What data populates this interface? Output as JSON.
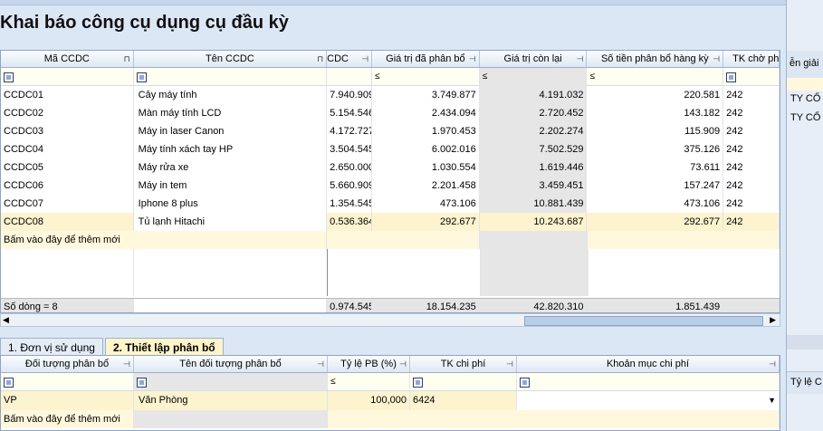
{
  "page_title": "Khai báo công cụ dụng cụ đầu kỳ",
  "main_grid": {
    "columns": [
      "Mã CCDC",
      "Tên CCDC",
      "CDC",
      "Giá trị đã phân bổ",
      "Giá trị còn lại",
      "Số tiền phân bổ hàng kỳ",
      "TK chờ ph"
    ],
    "filter_ops": [
      "≤",
      "≤",
      "≤"
    ],
    "rows": [
      {
        "code": "CCDC01",
        "name": "Cây máy tính",
        "cost": "7.940.909",
        "allocated": "3.749.877",
        "remaining": "4.191.032",
        "per_period": "220.581",
        "account": "242"
      },
      {
        "code": "CCDC02",
        "name": "Màn máy tính LCD",
        "cost": "5.154.546",
        "allocated": "2.434.094",
        "remaining": "2.720.452",
        "per_period": "143.182",
        "account": "242"
      },
      {
        "code": "CCDC03",
        "name": "Máy in laser Canon",
        "cost": "4.172.727",
        "allocated": "1.970.453",
        "remaining": "2.202.274",
        "per_period": "115.909",
        "account": "242"
      },
      {
        "code": "CCDC04",
        "name": "Máy tính xách tay HP",
        "cost": "3.504.545",
        "allocated": "6.002.016",
        "remaining": "7.502.529",
        "per_period": "375.126",
        "account": "242"
      },
      {
        "code": "CCDC05",
        "name": "Máy rửa xe",
        "cost": "2.650.000",
        "allocated": "1.030.554",
        "remaining": "1.619.446",
        "per_period": "73.611",
        "account": "242"
      },
      {
        "code": "CCDC06",
        "name": "Máy in tem",
        "cost": "5.660.909",
        "allocated": "2.201.458",
        "remaining": "3.459.451",
        "per_period": "157.247",
        "account": "242"
      },
      {
        "code": "CCDC07",
        "name": "Iphone 8 plus",
        "cost": "1.354.545",
        "allocated": "473.106",
        "remaining": "10.881.439",
        "per_period": "473.106",
        "account": "242"
      },
      {
        "code": "CCDC08",
        "name": "Tủ lạnh Hitachi",
        "cost": "0.536.364",
        "allocated": "292.677",
        "remaining": "10.243.687",
        "per_period": "292.677",
        "account": "242"
      }
    ],
    "add_row_text": "Bấm vào đây để thêm mới",
    "summary": {
      "count": "Số dòng = 8",
      "cost": "0.974.545",
      "allocated": "18.154.235",
      "remaining": "42.820.310",
      "per_period": "1.851.439"
    }
  },
  "tabs": [
    {
      "label": "1. Đơn vị sử dụng"
    },
    {
      "label": "2. Thiết lập phân bổ"
    }
  ],
  "alloc_grid": {
    "columns": [
      "Đối tượng phân bổ",
      "Tên đối tượng phân bổ",
      "Tỷ lệ PB (%)",
      "TK chi phí",
      "Khoản mục chi phí"
    ],
    "filter_op": "≤",
    "rows": [
      {
        "object": "VP",
        "object_name": "Văn Phòng",
        "ratio": "100,000",
        "account": "6424",
        "expense_item": ""
      }
    ],
    "add_row_text": "Bấm vào đây để thêm mới"
  },
  "right_panel": {
    "header": "ễn giải",
    "lines": [
      "TY CỔ",
      "TY CỔ"
    ],
    "bottom_header": "Tỷ lệ C"
  }
}
